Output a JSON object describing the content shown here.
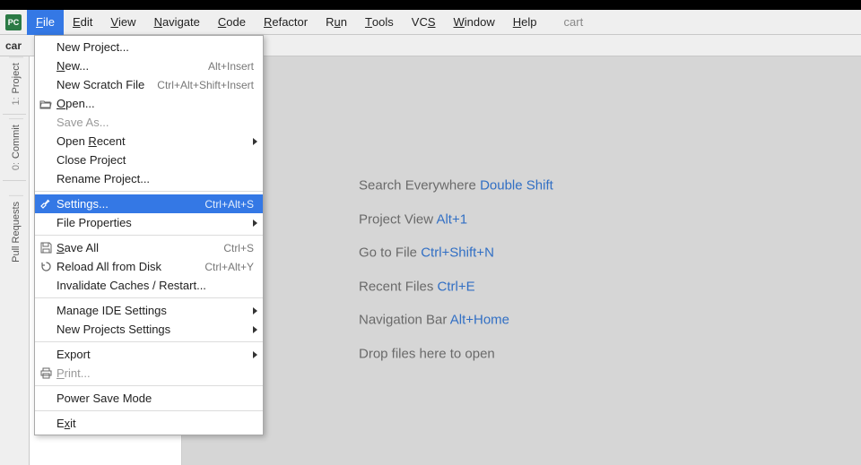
{
  "app_icon_text": "PC",
  "menubar": {
    "items": [
      {
        "html": "<u>F</u>ile"
      },
      {
        "html": "<u>E</u>dit"
      },
      {
        "html": "<u>V</u>iew"
      },
      {
        "html": "<u>N</u>avigate"
      },
      {
        "html": "<u>C</u>ode"
      },
      {
        "html": "<u>R</u>efactor"
      },
      {
        "html": "R<u>u</u>n"
      },
      {
        "html": "<u>T</u>ools"
      },
      {
        "html": "VC<u>S</u>"
      },
      {
        "html": "<u>W</u>indow"
      },
      {
        "html": "<u>H</u>elp"
      }
    ],
    "open_index": 0,
    "breadcrumb": "cart"
  },
  "toolbar": {
    "project_label": "car"
  },
  "gutter_tabs": [
    {
      "num": "1:",
      "label": "Project"
    },
    {
      "num": "0:",
      "label": "Commit"
    },
    {
      "num": "",
      "label": "Pull Requests"
    }
  ],
  "file_menu": {
    "groups": [
      [
        {
          "html": "New Project...",
          "shortcut": "",
          "icon": "",
          "submenu": false
        },
        {
          "html": "<u>N</u>ew...",
          "shortcut": "Alt+Insert",
          "icon": "",
          "submenu": false
        },
        {
          "html": "New Scratch File",
          "shortcut": "Ctrl+Alt+Shift+Insert",
          "icon": "",
          "submenu": false
        },
        {
          "html": "<u>O</u>pen...",
          "shortcut": "",
          "icon": "folder-open",
          "submenu": false
        },
        {
          "html": "Save As...",
          "shortcut": "",
          "icon": "",
          "submenu": false,
          "disabled": true
        },
        {
          "html": "Open <u>R</u>ecent",
          "shortcut": "",
          "icon": "",
          "submenu": true
        },
        {
          "html": "Close Project",
          "shortcut": "",
          "icon": "",
          "submenu": false
        },
        {
          "html": "Rename Project...",
          "shortcut": "",
          "icon": "",
          "submenu": false
        }
      ],
      [
        {
          "html": "Settings...",
          "shortcut": "Ctrl+Alt+S",
          "icon": "wrench",
          "submenu": false,
          "highlighted": true
        },
        {
          "html": "File Properties",
          "shortcut": "",
          "icon": "",
          "submenu": true
        }
      ],
      [
        {
          "html": "<u>S</u>ave All",
          "shortcut": "Ctrl+S",
          "icon": "save",
          "submenu": false
        },
        {
          "html": "Reload All from Disk",
          "shortcut": "Ctrl+Alt+Y",
          "icon": "reload",
          "submenu": false
        },
        {
          "html": "Invalidate Caches / Restart...",
          "shortcut": "",
          "icon": "",
          "submenu": false
        }
      ],
      [
        {
          "html": "Manage IDE Settings",
          "shortcut": "",
          "icon": "",
          "submenu": true
        },
        {
          "html": "New Projects Settings",
          "shortcut": "",
          "icon": "",
          "submenu": true
        }
      ],
      [
        {
          "html": "Export",
          "shortcut": "",
          "icon": "",
          "submenu": true
        },
        {
          "html": "<u>P</u>rint...",
          "shortcut": "",
          "icon": "print",
          "submenu": false,
          "disabled": true
        }
      ],
      [
        {
          "html": "Power Save Mode",
          "shortcut": "",
          "icon": "",
          "submenu": false
        }
      ],
      [
        {
          "html": "E<u>x</u>it",
          "shortcut": "",
          "icon": "",
          "submenu": false
        }
      ]
    ]
  },
  "welcome": {
    "lines": [
      {
        "text": "Search Everywhere ",
        "kbd": "Double Shift"
      },
      {
        "text": "Project View ",
        "kbd": "Alt+1"
      },
      {
        "text": "Go to File ",
        "kbd": "Ctrl+Shift+N"
      },
      {
        "text": "Recent Files ",
        "kbd": "Ctrl+E"
      },
      {
        "text": "Navigation Bar ",
        "kbd": "Alt+Home"
      },
      {
        "text": "Drop files here to open",
        "kbd": ""
      }
    ]
  }
}
